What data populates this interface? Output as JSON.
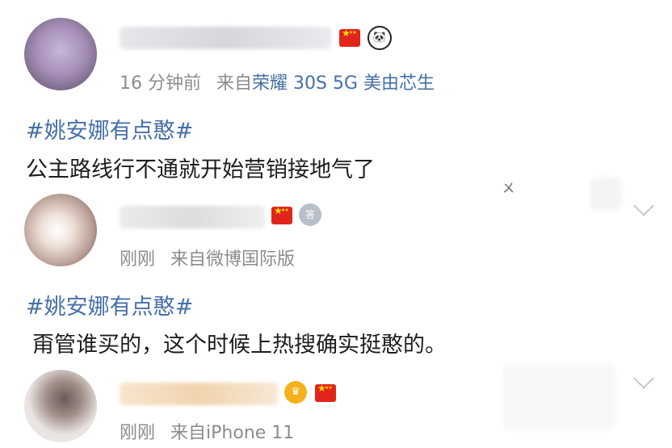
{
  "comments": [
    {
      "time": "16 分钟前",
      "source_prefix": "来自",
      "device": "荣耀 30S 5G 美由芯生",
      "hashtag": "#姚安娜有点憨#",
      "text": "公主路线行不通就开始营销接地气了",
      "badges": [
        "china-flag",
        "panda-badge"
      ]
    },
    {
      "time": "刚刚",
      "source_prefix": "来自",
      "device": "微博国际版",
      "hashtag": "#姚安娜有点憨#",
      "text": "甭管谁买的，这个时候上热搜确实挺憨的。",
      "badges": [
        "china-flag",
        "medal-badge"
      ]
    },
    {
      "time": "刚刚",
      "source_prefix": "来自",
      "device": "iPhone 11",
      "badges": [
        "crown-badge",
        "china-flag"
      ]
    }
  ],
  "icons": {
    "panda": "🐼",
    "medal": "答",
    "crown": "♛"
  },
  "colors": {
    "hashtag": "#456fa8",
    "meta": "#8c8c8c",
    "device_highlight": "#456fa8"
  },
  "stray_mark": "ㄨ"
}
